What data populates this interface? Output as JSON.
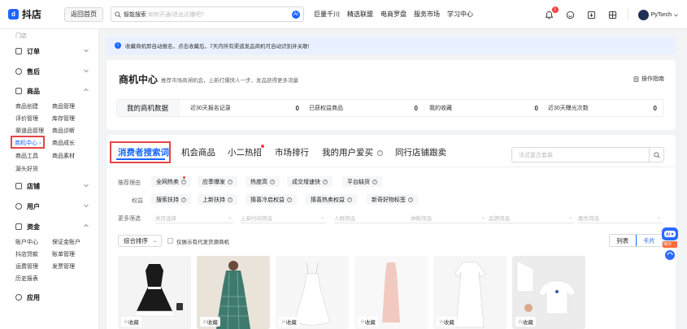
{
  "header": {
    "logo_text": "抖店",
    "home_button": "返回首页",
    "search_label": "智能搜索",
    "search_placeholder": "如何开通/退出达播吧?",
    "search_ai": "AI",
    "nav": [
      "巨量千川",
      "精选联盟",
      "电商罗盘",
      "服务市场",
      "学习中心"
    ],
    "notification_count": "1",
    "user_name": "PyTorch"
  },
  "sidebar": {
    "cut_top": "门店",
    "sections": [
      {
        "title": "订单"
      },
      {
        "title": "售后"
      },
      {
        "title": "商品",
        "items": [
          "商品创建",
          "商品管理",
          "评价管理",
          "库存管理",
          "渠道品管理",
          "商品诊断",
          "商机中心",
          "商品成长",
          "商品工具",
          "商品素材",
          "源头好货"
        ]
      },
      {
        "title": "店铺"
      },
      {
        "title": "用户"
      },
      {
        "title": "资金",
        "items": [
          "账户中心",
          "保证金账户",
          "抖店贷款",
          "账单管理",
          "运费管理",
          "发票管理",
          "历史报表"
        ]
      },
      {
        "title": "应用"
      }
    ],
    "active_item": "商机中心"
  },
  "notice": {
    "text": "收藏商机即自动报名，点击收藏后，7天内所有渠道发品商机可自动识别并关联!"
  },
  "overview": {
    "title": "商机中心",
    "subtitle": "推荐市场商溯机会，上新打爆快人一步，发品获得更多流量",
    "guide": "操作指南",
    "my_data_label": "我的商机数据",
    "stats": [
      {
        "label": "近30天报名记录",
        "value": "0"
      },
      {
        "label": "已获权益商品",
        "value": "0"
      },
      {
        "label": "我的收藏",
        "value": "0"
      },
      {
        "label": "近30天曝光次数",
        "value": "0"
      }
    ]
  },
  "tabs": {
    "items": [
      "消费者搜索词",
      "机会商品",
      "小二热招",
      "市场排行",
      "我的用户爱买",
      "同行店铺跟卖"
    ],
    "active": "消费者搜索词",
    "search_placeholder": "法式复古套装"
  },
  "filters": {
    "reason_label": "推荐理由",
    "reason_chips": [
      "全网热卖",
      "应季爆发",
      "热度高",
      "成交增速快",
      "平台缺货"
    ],
    "rights_label": "权益",
    "rights_chips": [
      "搜索扶持",
      "上新扶持",
      "猜喜冷启权益",
      "猜喜热卖权益",
      "新奇好物标签"
    ],
    "more_label": "更多筛选",
    "dropdowns": [
      "类目选择",
      "上新时间筛选",
      "人群筛选",
      "体裁筛选",
      "品牌筛选",
      "属性筛选"
    ]
  },
  "listing": {
    "sort_label": "综合排序",
    "checkbox_label": "仅展示有代发货源商机",
    "view_list": "列表",
    "view_card": "卡片",
    "fav_label": "收藏"
  },
  "helper": {
    "label": "AI",
    "tag": "待办"
  },
  "colors": {
    "brand": "#1966ff",
    "highlight": "#e64545",
    "dot": "#f53f3f"
  }
}
